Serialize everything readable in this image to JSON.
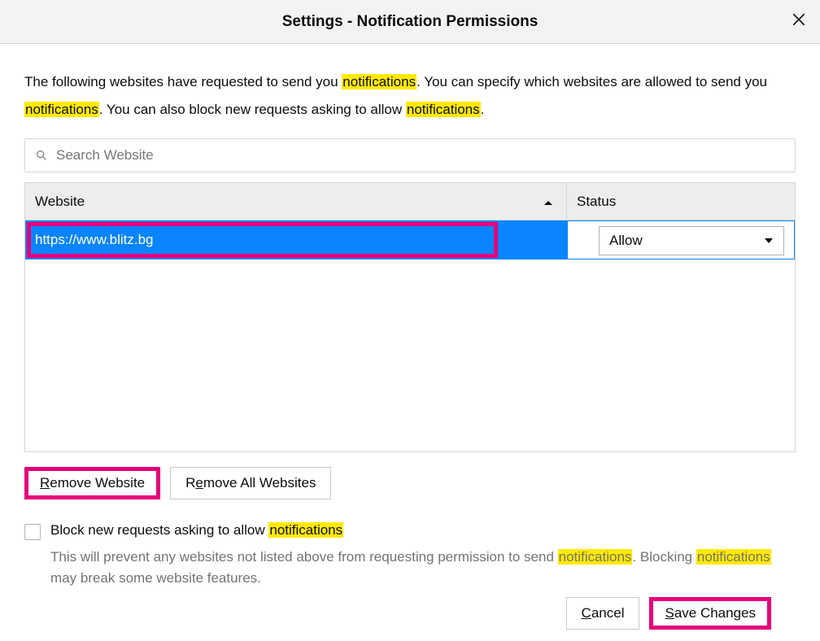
{
  "header": {
    "title": "Settings - Notification Permissions"
  },
  "intro": {
    "t1": "The following websites have requested to send you ",
    "h1": "notifications",
    "t2": ". You can specify which websites are allowed to send you ",
    "h2": "notifications",
    "t3": ". You can also block new requests asking to allow ",
    "h3": "notifications",
    "t4": "."
  },
  "search": {
    "placeholder": "Search Website"
  },
  "table": {
    "cols": {
      "website": "Website",
      "status": "Status"
    },
    "rows": [
      {
        "website": "https://www.blitz.bg",
        "status": "Allow",
        "selected": true
      }
    ]
  },
  "buttons": {
    "remove": "Remove Website",
    "removeAll": "Remove All Websites",
    "cancel": "Cancel",
    "save": "Save Changes"
  },
  "block": {
    "label_pre": "Block new requests asking to allow ",
    "label_hl": "notifications",
    "help_t1": "This will prevent any websites not listed above from requesting permission to send ",
    "help_h1": "notifications",
    "help_t2": ". Blocking ",
    "help_h2": "notifications",
    "help_t3": " may break some website features."
  }
}
